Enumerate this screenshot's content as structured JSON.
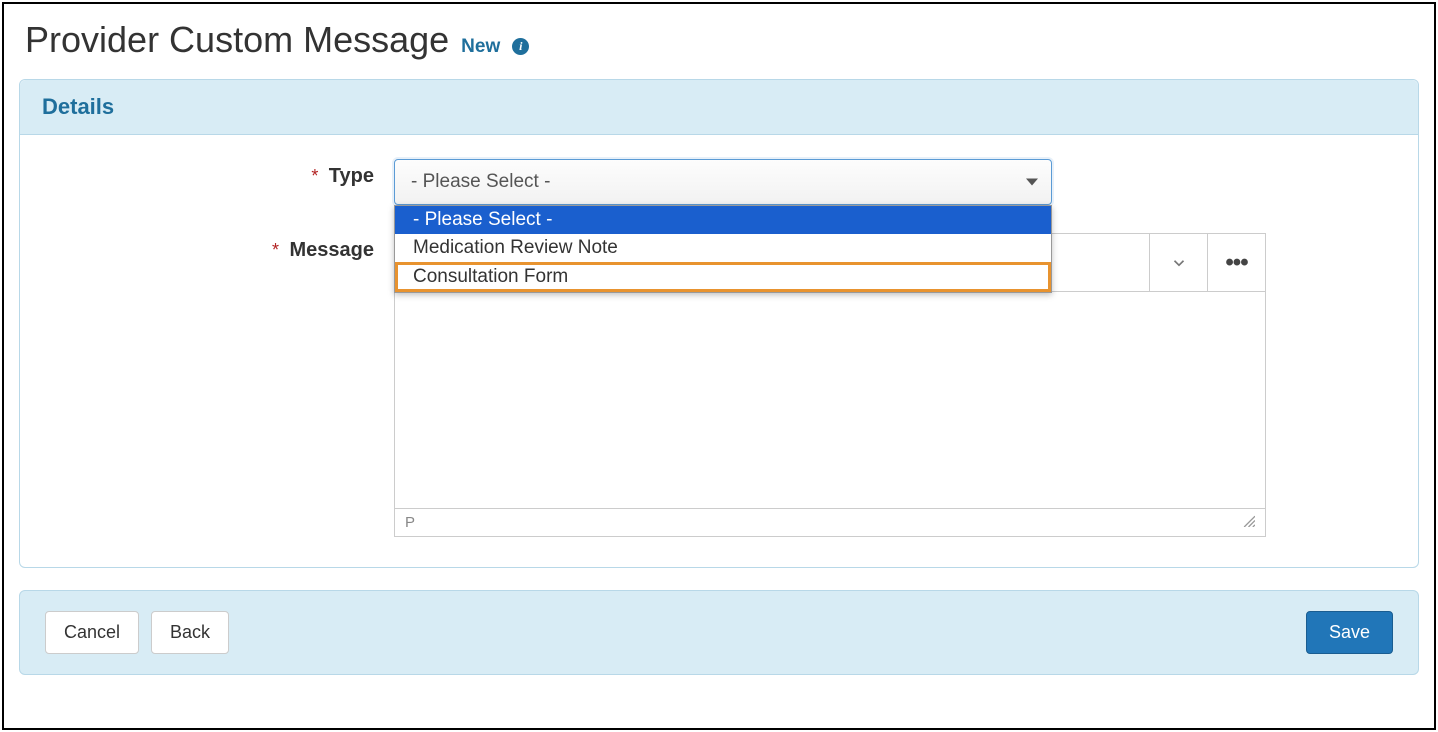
{
  "header": {
    "title": "Provider Custom Message",
    "status_label": "New",
    "info_glyph": "i"
  },
  "panel": {
    "title": "Details"
  },
  "fields": {
    "type": {
      "label": "Type",
      "selected": "- Please Select -",
      "options": [
        "- Please Select -",
        "Medication Review Note",
        "Consultation Form"
      ]
    },
    "message": {
      "label": "Message",
      "status_path": "P"
    }
  },
  "buttons": {
    "cancel": "Cancel",
    "back": "Back",
    "save": "Save"
  }
}
